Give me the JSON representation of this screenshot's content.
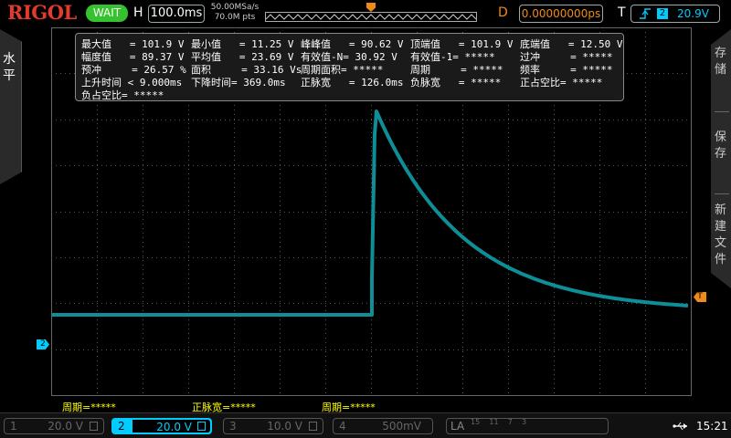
{
  "top": {
    "brand": "RIGOL",
    "run_state": "WAIT",
    "h_label": "H",
    "timebase": "100.0ms",
    "sample_rate": "50.00MSa/s",
    "mem_depth": "70.0M pts",
    "d_label": "D",
    "delay": "0.00000000ps",
    "t_label": "T",
    "trigger_source": "2",
    "trigger_level": "20.9V"
  },
  "side_left": {
    "label": "水平"
  },
  "side_right": {
    "items": [
      "存储",
      "保存",
      "新建文件"
    ]
  },
  "measurements": [
    [
      "最大值   = 101.9 V",
      "最小值   = 11.25 V",
      "峰峰值   = 90.62 V",
      "顶端值   = 101.9 V",
      "底端值   = 12.50 V"
    ],
    [
      "幅度值   = 89.37 V",
      "平均值   = 23.69 V",
      "有效值-N= 30.92 V",
      "有效值-1= *****",
      "过冲     = *****"
    ],
    [
      "预冲     = 26.57 %",
      "面积     = 33.16 Vs",
      "周期面积= *****",
      "周期     = *****",
      "频率     = *****"
    ],
    [
      "上升时间 < 9.000ms",
      "下降时间= 369.0ms",
      "正脉宽   = 126.0ms",
      "负脉宽   = *****",
      "正占空比= *****"
    ],
    [
      "负占空比= *****"
    ]
  ],
  "markers": {
    "ch2": "2",
    "trig": "T"
  },
  "bottom_stats": [
    "周期=*****",
    "正脉宽=*****",
    "周期=*****"
  ],
  "channels": [
    {
      "num": "1",
      "scale": "20.0 V",
      "active": false
    },
    {
      "num": "2",
      "scale": "20.0 V",
      "active": true
    },
    {
      "num": "3",
      "scale": "10.0 V",
      "active": false
    },
    {
      "num": "4",
      "scale": "500mV",
      "active": false
    }
  ],
  "la": {
    "label": "LA",
    "digits": "15    11    7    3"
  },
  "clock": "15:21",
  "colors": {
    "ch2": "#00ccff",
    "trace": "#0e8e96",
    "trigger": "#f08a1a",
    "run": "#36c22e",
    "brand": "#e43a2a",
    "stats": "#ffff00"
  }
}
